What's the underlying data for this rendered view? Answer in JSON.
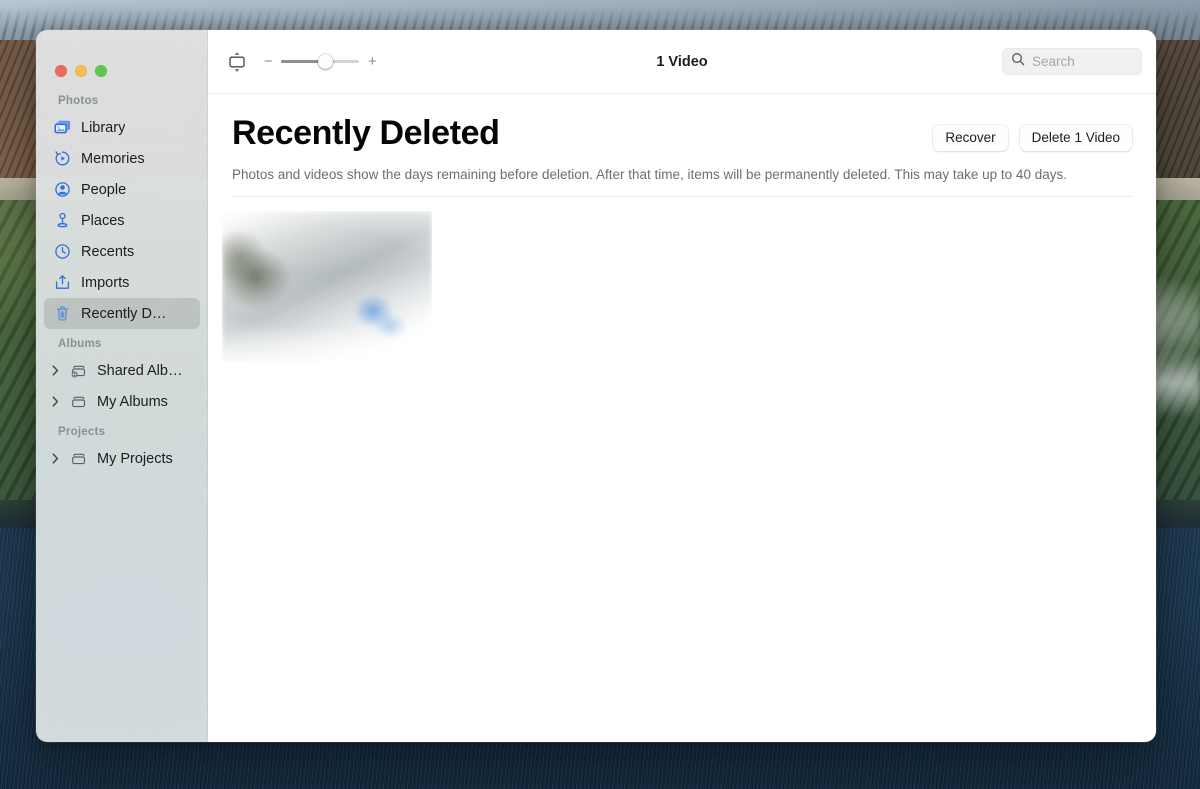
{
  "window": {
    "traffic_lights": [
      "close",
      "minimize",
      "maximize"
    ],
    "colors": {
      "close": "#ec6a5f",
      "minimize": "#f4bd4f",
      "maximize": "#61c554"
    }
  },
  "toolbar": {
    "aspect_icon": "aspect-view-icon",
    "zoom": {
      "decrease": "−",
      "increase": "+",
      "value_percent": 52
    },
    "title": "1 Video",
    "search": {
      "icon": "search-icon",
      "placeholder": "Search",
      "value": ""
    }
  },
  "sidebar": {
    "sections": [
      {
        "label": "Photos",
        "items": [
          {
            "label": "Library",
            "icon": "library-icon",
            "selected": false,
            "expandable": false
          },
          {
            "label": "Memories",
            "icon": "memories-icon",
            "selected": false,
            "expandable": false
          },
          {
            "label": "People",
            "icon": "people-icon",
            "selected": false,
            "expandable": false
          },
          {
            "label": "Places",
            "icon": "places-pin-icon",
            "selected": false,
            "expandable": false
          },
          {
            "label": "Recents",
            "icon": "recents-clock-icon",
            "selected": false,
            "expandable": false
          },
          {
            "label": "Imports",
            "icon": "imports-icon",
            "selected": false,
            "expandable": false
          },
          {
            "label": "Recently D…",
            "icon": "trash-icon",
            "selected": true,
            "expandable": false
          }
        ]
      },
      {
        "label": "Albums",
        "items": [
          {
            "label": "Shared Alb…",
            "icon": "shared-album-icon",
            "selected": false,
            "expandable": true
          },
          {
            "label": "My Albums",
            "icon": "album-icon",
            "selected": false,
            "expandable": true
          }
        ]
      },
      {
        "label": "Projects",
        "items": [
          {
            "label": "My Projects",
            "icon": "project-icon",
            "selected": false,
            "expandable": true
          }
        ]
      }
    ]
  },
  "header": {
    "title": "Recently Deleted",
    "description": "Photos and videos show the days remaining before deletion. After that time, items will be permanently deleted. This may take up to 40 days.",
    "actions": [
      {
        "label": "Recover"
      },
      {
        "label": "Delete 1 Video"
      }
    ]
  },
  "content": {
    "items": [
      {
        "type": "video",
        "alt": "deleted video thumbnail"
      }
    ]
  }
}
